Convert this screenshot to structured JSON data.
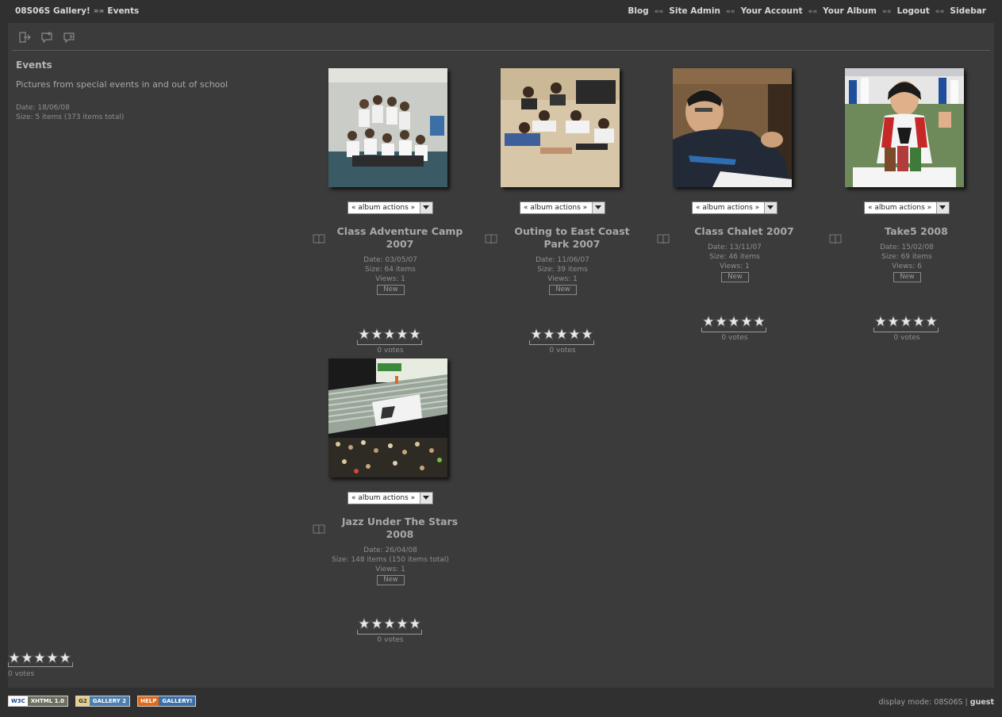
{
  "breadcrumb": {
    "home": "08S06S Gallery!",
    "separator": "»»",
    "current": "Events"
  },
  "nav": {
    "separator": "««",
    "links": [
      "Blog",
      "Site Admin",
      "Your Account",
      "Your Album",
      "Logout",
      "Sidebar"
    ]
  },
  "toolbar": {
    "icons": [
      "exit-icon",
      "comment-add-icon",
      "comment-view-icon"
    ]
  },
  "album_info": {
    "title": "Events",
    "description": "Pictures from special events in and out of school",
    "date": "Date: 18/06/08",
    "size": "Size: 5 items (373 items total)"
  },
  "albums": [
    {
      "title": "Class Adventure Camp 2007",
      "actions": "« album actions »",
      "date": "Date: 03/05/07",
      "size": "Size: 64 items",
      "views": "Views: 1",
      "badge": "New",
      "votes": "0 votes",
      "rating": 0
    },
    {
      "title": "Outing to East Coast Park 2007",
      "actions": "« album actions »",
      "date": "Date: 11/06/07",
      "size": "Size: 39 items",
      "views": "Views: 1",
      "badge": "New",
      "votes": "0 votes",
      "rating": 0
    },
    {
      "title": "Class Chalet 2007",
      "actions": "« album actions »",
      "date": "Date: 13/11/07",
      "size": "Size: 46 items",
      "views": "Views: 1",
      "badge": "New",
      "votes": "0 votes",
      "rating": 0
    },
    {
      "title": "Take5 2008",
      "actions": "« album actions »",
      "date": "Date: 15/02/08",
      "size": "Size: 69 items",
      "views": "Views: 6",
      "badge": "New",
      "votes": "0 votes",
      "rating": 0
    },
    {
      "title": "Jazz Under The Stars 2008",
      "actions": "« album actions »",
      "date": "Date: 26/04/08",
      "size": "Size: 148 items (150 items total)",
      "views": "Views: 1",
      "badge": "New",
      "votes": "0 votes",
      "rating": 0
    }
  ],
  "page_rating": {
    "votes": "0 votes",
    "rating": 0
  },
  "footer": {
    "badges": [
      {
        "left": "W3C",
        "right": "XHTML 1.0"
      },
      {
        "left": "G2",
        "right": "GALLERY 2"
      },
      {
        "left": "HELP",
        "right": "GALLERY!"
      }
    ],
    "display_mode_label": "display mode: 08S06S |",
    "user": "guest"
  },
  "colors": {
    "background": "#303030",
    "panel": "#3b3b3b",
    "text": "#9a9a9a",
    "link": "#d8d8d8"
  }
}
